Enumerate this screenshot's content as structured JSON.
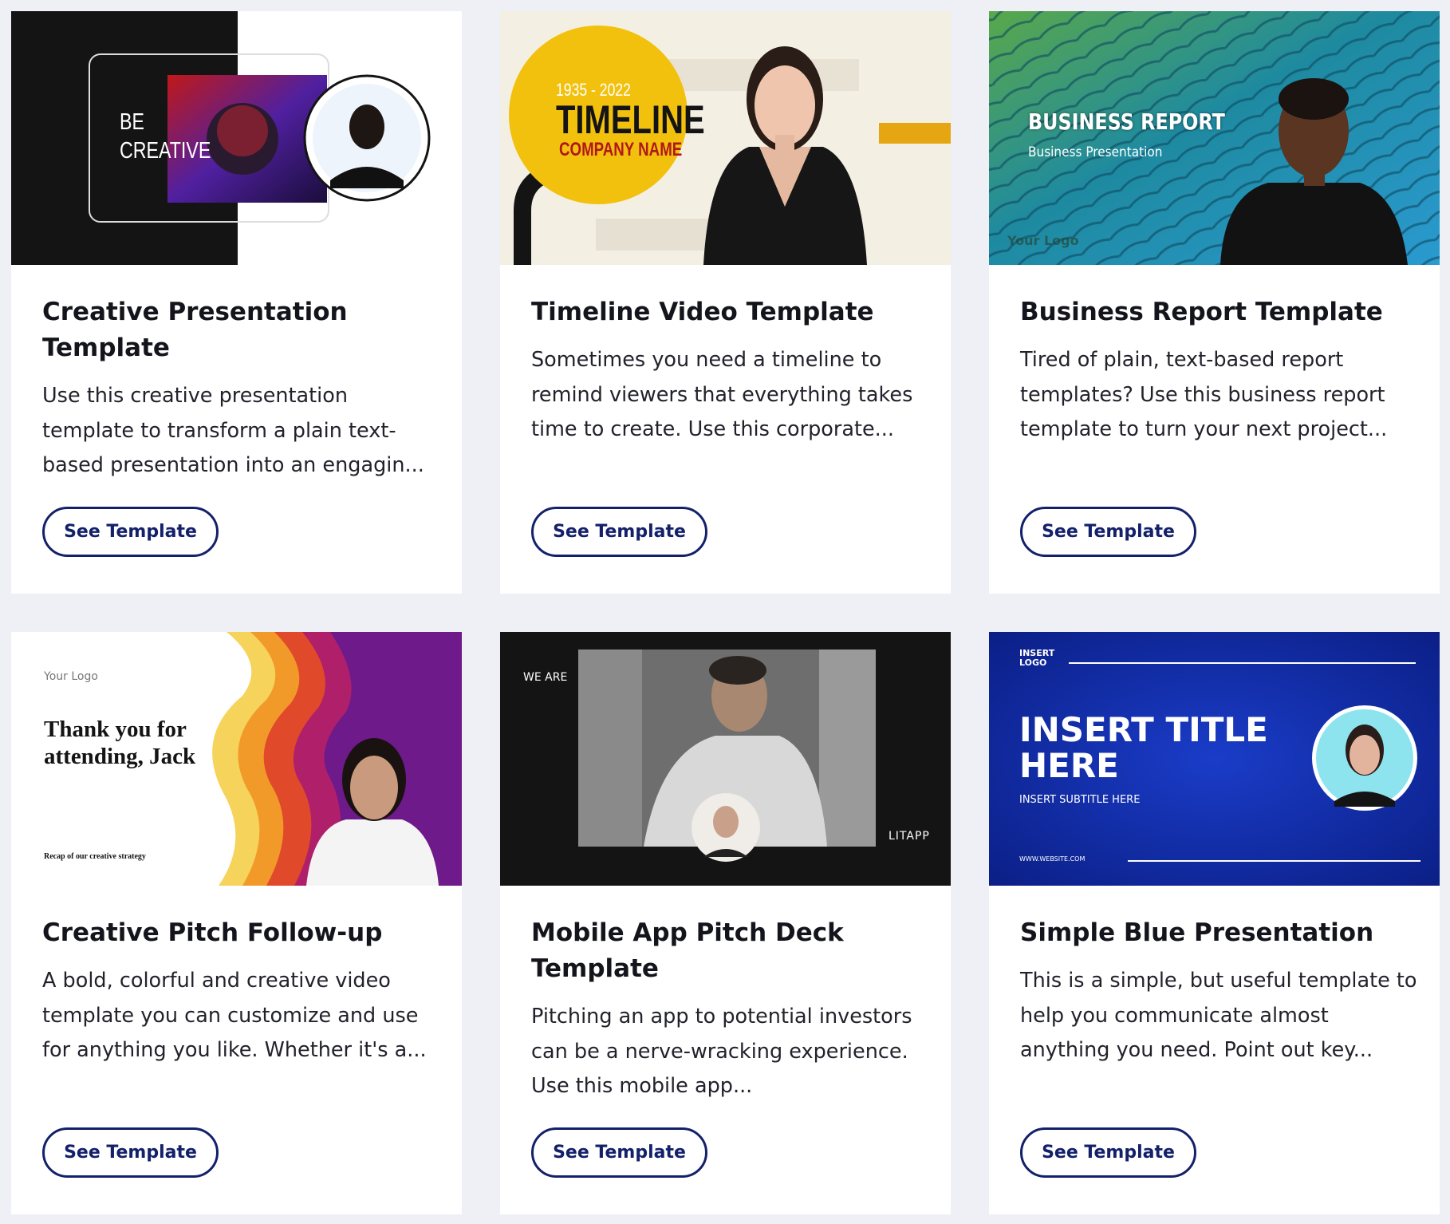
{
  "cards": [
    {
      "title": "Creative Presentation Template",
      "description": "Use this creative presentation template to transform a plain text-based presentation into an engagin...",
      "button_label": "See Template",
      "thumbnail": {
        "line1": "BE",
        "line2": "CREATIVE"
      }
    },
    {
      "title": "Timeline Video Template",
      "description": "Sometimes you need a timeline to remind viewers that everything takes time to create. Use this corporate...",
      "button_label": "See Template",
      "thumbnail": {
        "years": "1935 - 2022",
        "heading": "TIMELINE",
        "subheading": "COMPANY NAME"
      }
    },
    {
      "title": "Business Report Template",
      "description": "Tired of plain, text-based report templates? Use this business report template to turn your next project...",
      "button_label": "See Template",
      "thumbnail": {
        "heading": "BUSINESS REPORT",
        "subheading": "Business Presentation",
        "logo": "Your Logo"
      }
    },
    {
      "title": "Creative Pitch Follow-up",
      "description": "A bold, colorful and creative video template you can customize and use for anything you like. Whether it's a...",
      "button_label": "See Template",
      "thumbnail": {
        "logo": "Your Logo",
        "heading": "Thank you for attending, Jack",
        "caption": "Recap of our creative strategy"
      }
    },
    {
      "title": "Mobile App Pitch Deck Template",
      "description": "Pitching an app to potential investors can be a nerve-wracking experience. Use this mobile app...",
      "button_label": "See Template",
      "thumbnail": {
        "tag": "WE ARE",
        "brand": "LITAPP"
      }
    },
    {
      "title": "Simple Blue Presentation",
      "description": "This is a simple, but useful template to help you communicate almost anything you need. Point out key...",
      "button_label": "See Template",
      "thumbnail": {
        "logo": "INSERT LOGO",
        "heading": "INSERT TITLE HERE",
        "subheading": "INSERT SUBTITLE HERE",
        "website": "WWW.WEBSITE.COM"
      }
    }
  ],
  "colors": {
    "page_background": "#eef0f5",
    "card_background": "#ffffff",
    "button_border": "#13206a",
    "title_text": "#14141c"
  }
}
